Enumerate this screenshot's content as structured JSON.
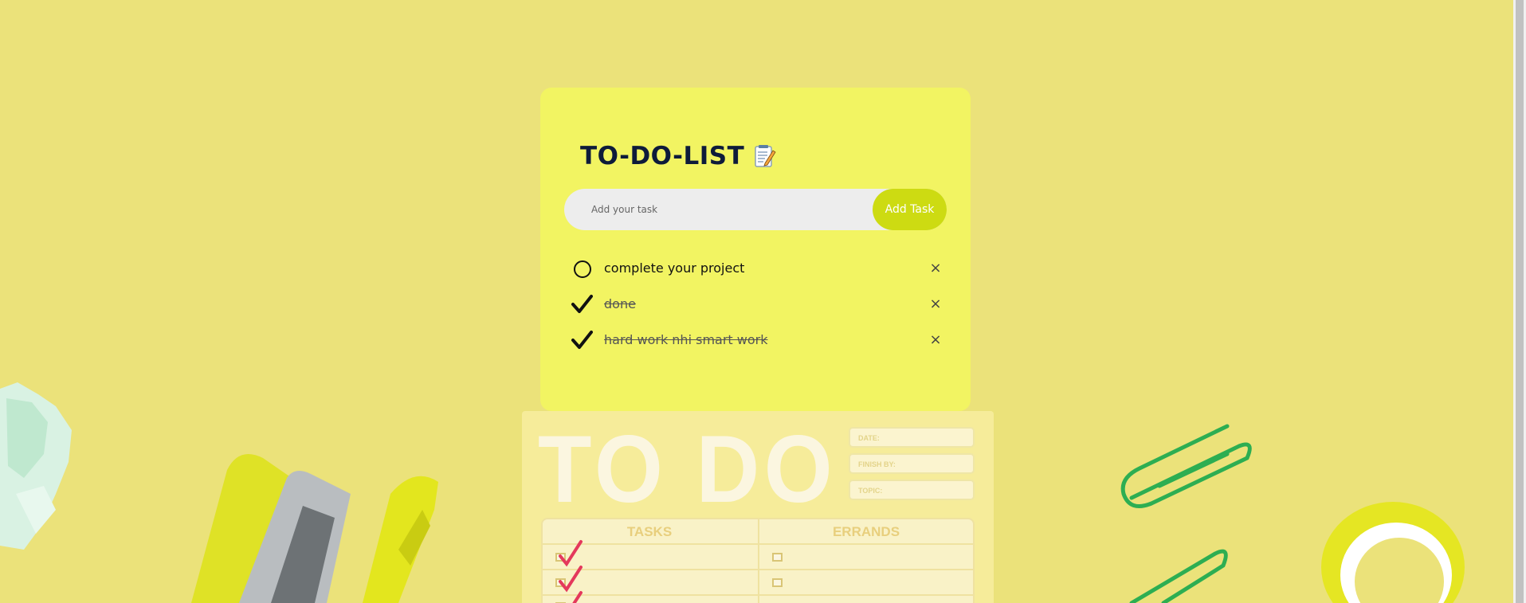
{
  "app": {
    "title": "TO-DO-LIST",
    "title_icon": "memo-icon"
  },
  "composer": {
    "placeholder": "Add your task",
    "value": "",
    "add_label": "Add Task"
  },
  "tasks": [
    {
      "text": "complete your project",
      "done": false
    },
    {
      "text": "done",
      "done": true
    },
    {
      "text": "hard work nhi smart work",
      "done": true
    }
  ],
  "delete_glyph": "×",
  "background": {
    "notepad": {
      "heading": "TO DO",
      "fields": [
        "DATE:",
        "FINISH BY:",
        "TOPIC:"
      ],
      "columns": [
        "TASKS",
        "ERRANDS"
      ]
    }
  },
  "colors": {
    "page_background": "#ebe27a",
    "card": "#f2f462",
    "button": "#cddb12",
    "input": "#ededed"
  }
}
